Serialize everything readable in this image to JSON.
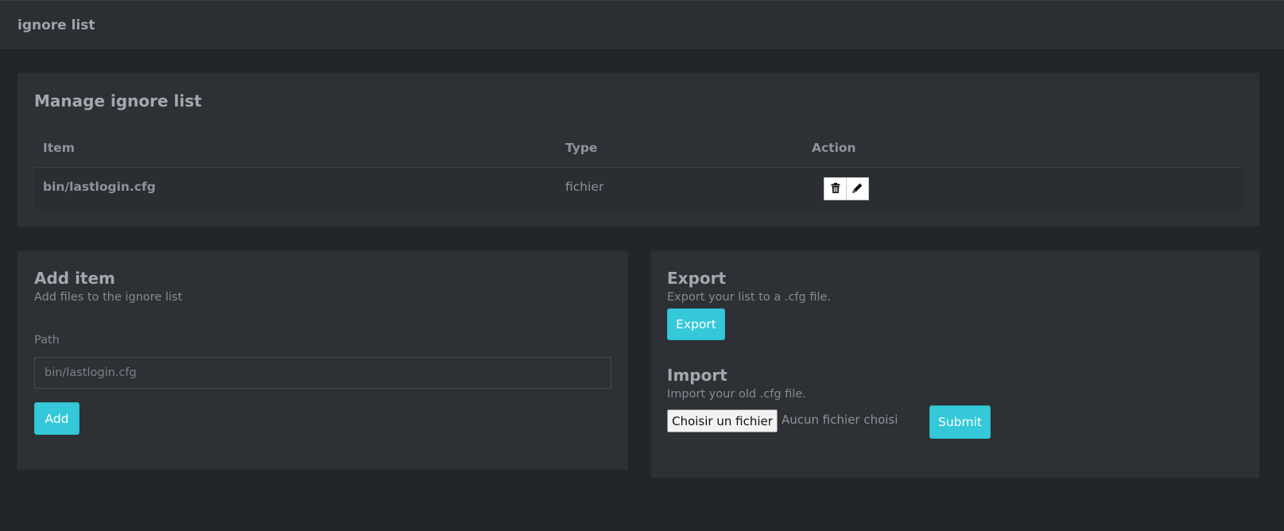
{
  "topbar": {
    "title": "ignore list"
  },
  "manage": {
    "title": "Manage ignore list",
    "columns": {
      "item": "Item",
      "type": "Type",
      "action": "Action"
    },
    "rows": [
      {
        "item": "bin/lastlogin.cfg",
        "type": "fichier",
        "actions": [
          "trash-icon",
          "pencil-icon"
        ]
      }
    ]
  },
  "add_item": {
    "title": "Add item",
    "subtitle": "Add files to the ignore list",
    "path_label": "Path",
    "path_placeholder": "bin/lastlogin.cfg",
    "path_value": "",
    "add_label": "Add"
  },
  "export": {
    "title": "Export",
    "subtitle": "Export your list to a .cfg file.",
    "button_label": "Export"
  },
  "import": {
    "title": "Import",
    "subtitle": "Import your old .cfg file.",
    "choose_label": "Choisir un fichier",
    "no_file_label": "Aucun fichier choisi",
    "submit_label": "Submit"
  },
  "colors": {
    "background": "#222529",
    "card": "#2d3035",
    "accent": "#34c8d9"
  }
}
